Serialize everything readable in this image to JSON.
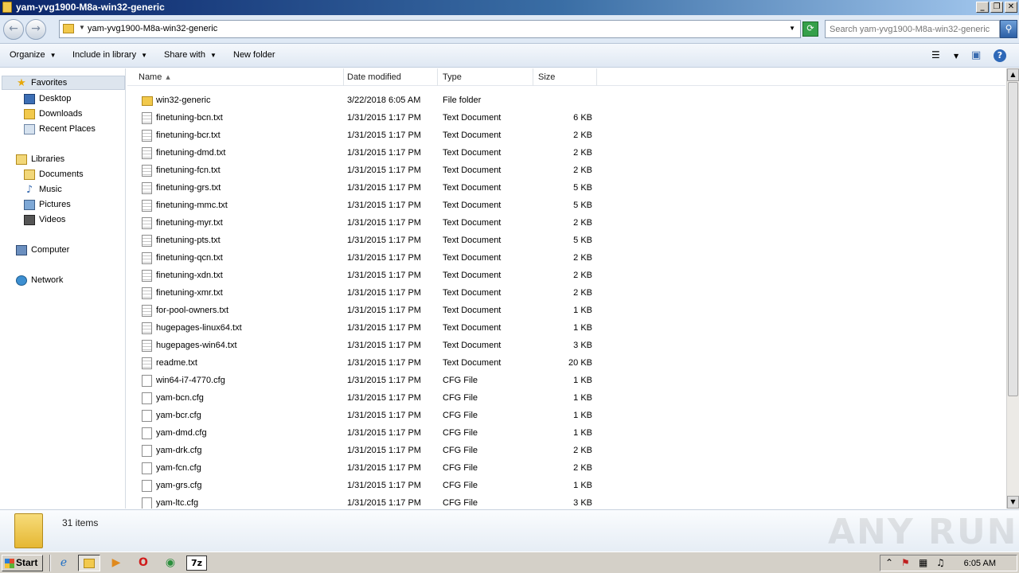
{
  "window": {
    "title": "yam-yvg1900-M8a-win32-generic",
    "controls": {
      "minimize": "_",
      "maximize": "❐",
      "close": "✕"
    }
  },
  "address": {
    "path": "yam-yvg1900-M8a-win32-generic",
    "search_placeholder": "Search yam-yvg1900-M8a-win32-generic"
  },
  "toolbar": {
    "organize": "Organize",
    "include_in_library": "Include in library",
    "share_with": "Share with",
    "new_folder": "New folder"
  },
  "nav": {
    "favorites": "Favorites",
    "desktop": "Desktop",
    "downloads": "Downloads",
    "recent_places": "Recent Places",
    "libraries": "Libraries",
    "documents": "Documents",
    "music": "Music",
    "pictures": "Pictures",
    "videos": "Videos",
    "computer": "Computer",
    "network": "Network"
  },
  "columns": {
    "name": "Name",
    "date": "Date modified",
    "type": "Type",
    "size": "Size"
  },
  "files": [
    {
      "name": "win32-generic",
      "date": "3/22/2018 6:05 AM",
      "type": "File folder",
      "size": "",
      "icon": "folder-icon"
    },
    {
      "name": "finetuning-bcn.txt",
      "date": "1/31/2015 1:17 PM",
      "type": "Text Document",
      "size": "6 KB",
      "icon": "text-file-icon"
    },
    {
      "name": "finetuning-bcr.txt",
      "date": "1/31/2015 1:17 PM",
      "type": "Text Document",
      "size": "2 KB",
      "icon": "text-file-icon"
    },
    {
      "name": "finetuning-dmd.txt",
      "date": "1/31/2015 1:17 PM",
      "type": "Text Document",
      "size": "2 KB",
      "icon": "text-file-icon"
    },
    {
      "name": "finetuning-fcn.txt",
      "date": "1/31/2015 1:17 PM",
      "type": "Text Document",
      "size": "2 KB",
      "icon": "text-file-icon"
    },
    {
      "name": "finetuning-grs.txt",
      "date": "1/31/2015 1:17 PM",
      "type": "Text Document",
      "size": "5 KB",
      "icon": "text-file-icon"
    },
    {
      "name": "finetuning-mmc.txt",
      "date": "1/31/2015 1:17 PM",
      "type": "Text Document",
      "size": "5 KB",
      "icon": "text-file-icon"
    },
    {
      "name": "finetuning-myr.txt",
      "date": "1/31/2015 1:17 PM",
      "type": "Text Document",
      "size": "2 KB",
      "icon": "text-file-icon"
    },
    {
      "name": "finetuning-pts.txt",
      "date": "1/31/2015 1:17 PM",
      "type": "Text Document",
      "size": "5 KB",
      "icon": "text-file-icon"
    },
    {
      "name": "finetuning-qcn.txt",
      "date": "1/31/2015 1:17 PM",
      "type": "Text Document",
      "size": "2 KB",
      "icon": "text-file-icon"
    },
    {
      "name": "finetuning-xdn.txt",
      "date": "1/31/2015 1:17 PM",
      "type": "Text Document",
      "size": "2 KB",
      "icon": "text-file-icon"
    },
    {
      "name": "finetuning-xmr.txt",
      "date": "1/31/2015 1:17 PM",
      "type": "Text Document",
      "size": "2 KB",
      "icon": "text-file-icon"
    },
    {
      "name": "for-pool-owners.txt",
      "date": "1/31/2015 1:17 PM",
      "type": "Text Document",
      "size": "1 KB",
      "icon": "text-file-icon"
    },
    {
      "name": "hugepages-linux64.txt",
      "date": "1/31/2015 1:17 PM",
      "type": "Text Document",
      "size": "1 KB",
      "icon": "text-file-icon"
    },
    {
      "name": "hugepages-win64.txt",
      "date": "1/31/2015 1:17 PM",
      "type": "Text Document",
      "size": "3 KB",
      "icon": "text-file-icon"
    },
    {
      "name": "readme.txt",
      "date": "1/31/2015 1:17 PM",
      "type": "Text Document",
      "size": "20 KB",
      "icon": "text-file-icon"
    },
    {
      "name": "win64-i7-4770.cfg",
      "date": "1/31/2015 1:17 PM",
      "type": "CFG File",
      "size": "1 KB",
      "icon": "cfg-file-icon"
    },
    {
      "name": "yam-bcn.cfg",
      "date": "1/31/2015 1:17 PM",
      "type": "CFG File",
      "size": "1 KB",
      "icon": "cfg-file-icon"
    },
    {
      "name": "yam-bcr.cfg",
      "date": "1/31/2015 1:17 PM",
      "type": "CFG File",
      "size": "1 KB",
      "icon": "cfg-file-icon"
    },
    {
      "name": "yam-dmd.cfg",
      "date": "1/31/2015 1:17 PM",
      "type": "CFG File",
      "size": "1 KB",
      "icon": "cfg-file-icon"
    },
    {
      "name": "yam-drk.cfg",
      "date": "1/31/2015 1:17 PM",
      "type": "CFG File",
      "size": "2 KB",
      "icon": "cfg-file-icon"
    },
    {
      "name": "yam-fcn.cfg",
      "date": "1/31/2015 1:17 PM",
      "type": "CFG File",
      "size": "2 KB",
      "icon": "cfg-file-icon"
    },
    {
      "name": "yam-grs.cfg",
      "date": "1/31/2015 1:17 PM",
      "type": "CFG File",
      "size": "1 KB",
      "icon": "cfg-file-icon"
    },
    {
      "name": "yam-ltc.cfg",
      "date": "1/31/2015 1:17 PM",
      "type": "CFG File",
      "size": "3 KB",
      "icon": "cfg-file-icon"
    }
  ],
  "details": {
    "items_count": "31 items",
    "watermark": "ANY RUN"
  },
  "taskbar": {
    "start": "Start",
    "clock": "6:05 AM"
  }
}
